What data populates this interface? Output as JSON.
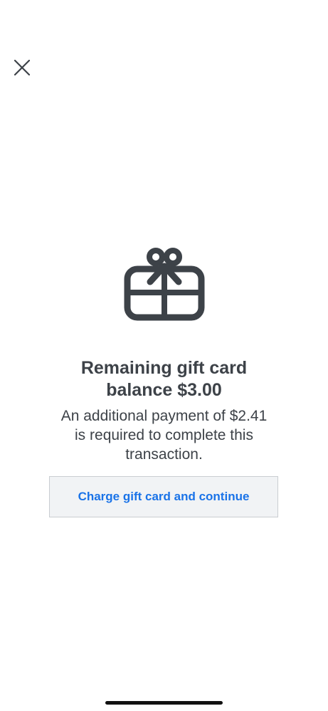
{
  "header": {
    "close_icon": "close-icon"
  },
  "content": {
    "icon": "gift-icon",
    "title_line1": "Remaining gift card",
    "title_line2": "balance $3.00",
    "message_line1": "An additional payment of $2.41",
    "message_line2": "is required to complete this",
    "message_line3": "transaction.",
    "button_label": "Charge gift card and continue"
  },
  "colors": {
    "text": "#3d4248",
    "accent": "#1a73e8",
    "button_bg": "#f1f3f5",
    "button_border": "#c9cdd1"
  }
}
